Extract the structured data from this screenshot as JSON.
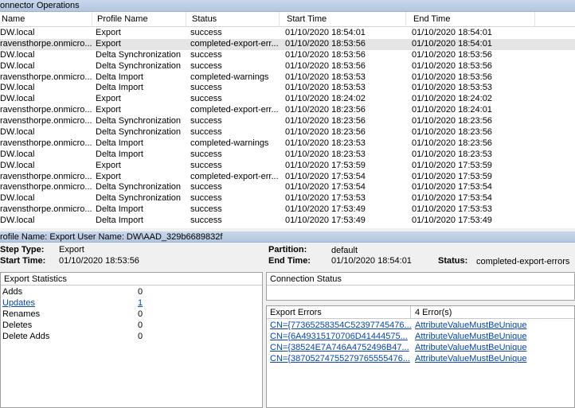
{
  "connector_operations": {
    "title": "onnector Operations",
    "columns": [
      "Name",
      "Profile Name",
      "Status",
      "Start Time",
      "End Time"
    ],
    "rows": [
      [
        "DW.local",
        "Export",
        "success",
        "01/10/2020 18:54:01",
        "01/10/2020 18:54:01"
      ],
      [
        "ravensthorpe.onmicro...",
        "Export",
        "completed-export-err...",
        "01/10/2020 18:53:56",
        "01/10/2020 18:54:01"
      ],
      [
        "DW.local",
        "Delta Synchronization",
        "success",
        "01/10/2020 18:53:56",
        "01/10/2020 18:53:56"
      ],
      [
        "DW.local",
        "Delta Synchronization",
        "success",
        "01/10/2020 18:53:56",
        "01/10/2020 18:53:56"
      ],
      [
        "ravensthorpe.onmicro...",
        "Delta Import",
        "completed-warnings",
        "01/10/2020 18:53:53",
        "01/10/2020 18:53:56"
      ],
      [
        "DW.local",
        "Delta Import",
        "success",
        "01/10/2020 18:53:53",
        "01/10/2020 18:53:53"
      ],
      [
        "DW.local",
        "Export",
        "success",
        "01/10/2020 18:24:02",
        "01/10/2020 18:24:02"
      ],
      [
        "ravensthorpe.onmicro...",
        "Export",
        "completed-export-err...",
        "01/10/2020 18:23:56",
        "01/10/2020 18:24:01"
      ],
      [
        "ravensthorpe.onmicro...",
        "Delta Synchronization",
        "success",
        "01/10/2020 18:23:56",
        "01/10/2020 18:23:56"
      ],
      [
        "DW.local",
        "Delta Synchronization",
        "success",
        "01/10/2020 18:23:56",
        "01/10/2020 18:23:56"
      ],
      [
        "ravensthorpe.onmicro...",
        "Delta Import",
        "completed-warnings",
        "01/10/2020 18:23:53",
        "01/10/2020 18:23:56"
      ],
      [
        "DW.local",
        "Delta Import",
        "success",
        "01/10/2020 18:23:53",
        "01/10/2020 18:23:53"
      ],
      [
        "DW.local",
        "Export",
        "success",
        "01/10/2020 17:53:59",
        "01/10/2020 17:53:59"
      ],
      [
        "ravensthorpe.onmicro...",
        "Export",
        "completed-export-err...",
        "01/10/2020 17:53:54",
        "01/10/2020 17:53:59"
      ],
      [
        "ravensthorpe.onmicro...",
        "Delta Synchronization",
        "success",
        "01/10/2020 17:53:54",
        "01/10/2020 17:53:54"
      ],
      [
        "DW.local",
        "Delta Synchronization",
        "success",
        "01/10/2020 17:53:53",
        "01/10/2020 17:53:54"
      ],
      [
        "ravensthorpe.onmicro...",
        "Delta Import",
        "success",
        "01/10/2020 17:53:49",
        "01/10/2020 17:53:53"
      ],
      [
        "DW.local",
        "Delta Import",
        "success",
        "01/10/2020 17:53:49",
        "01/10/2020 17:53:49"
      ]
    ],
    "selected_row": 1
  },
  "profile_bar": {
    "text": "rofile Name: Export  User Name: DW\\AAD_329b6689832f"
  },
  "details": {
    "step_type_label": "Step Type:",
    "step_type_value": "Export",
    "start_time_label": "Start Time:",
    "start_time_value": "01/10/2020 18:53:56",
    "partition_label": "Partition:",
    "partition_value": "default",
    "end_time_label": "End Time:",
    "end_time_value": "01/10/2020 18:54:01",
    "status_label": "Status:",
    "status_value": "completed-export-errors"
  },
  "export_statistics": {
    "header": "Export Statistics",
    "rows": [
      {
        "label": "Adds",
        "value": "0",
        "link": false
      },
      {
        "label": "Updates",
        "value": "1",
        "link": true
      },
      {
        "label": "Renames",
        "value": "0",
        "link": false
      },
      {
        "label": "Deletes",
        "value": "0",
        "link": false
      },
      {
        "label": "Delete Adds",
        "value": "0",
        "link": false
      }
    ]
  },
  "connection_status": {
    "header": "Connection Status"
  },
  "export_errors": {
    "header": "Export Errors",
    "count": "4 Error(s)",
    "rows": [
      {
        "dn": "CN={77365258354C52397745476...",
        "error": "AttributeValueMustBeUnique"
      },
      {
        "dn": "CN={6A49315170706D41444575...",
        "error": "AttributeValueMustBeUnique"
      },
      {
        "dn": "CN={38524E7A746A4752496B47...",
        "error": "AttributeValueMustBeUnique"
      },
      {
        "dn": "CN={38705274755279765555476...",
        "error": "AttributeValueMustBeUnique"
      }
    ]
  }
}
